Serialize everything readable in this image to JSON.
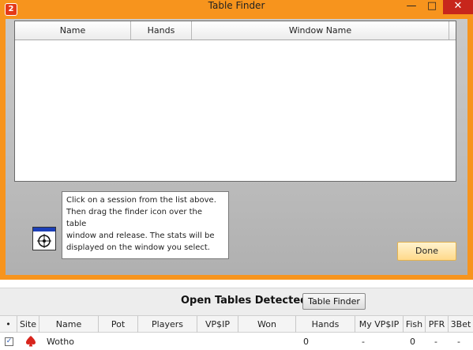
{
  "window": {
    "app_icon_text": "2",
    "title": "Table Finder",
    "controls": {
      "minimize": "—",
      "maximize": "□",
      "close": "✕"
    }
  },
  "session_list": {
    "columns": [
      "Name",
      "Hands",
      "Window Name"
    ],
    "rows": []
  },
  "instructions": "Click on a session from the list above.\nThen drag the finder icon over the table\nwindow and release. The stats will be\ndisplayed on the window you select.",
  "finder_icon": "crosshair-target-icon",
  "done_label": "Done",
  "open_tables": {
    "title": "Open Tables Detected",
    "table_finder_button": "Table Finder",
    "columns": [
      "•",
      "Site",
      "Name",
      "Pot",
      "Players",
      "VP$IP",
      "Won",
      "Hands",
      "My VP$IP",
      "Fish",
      "PFR",
      "3Bet"
    ],
    "rows": [
      {
        "checked": true,
        "site_icon": "poker-spade-icon",
        "name": "Wotho",
        "pot": "",
        "players": "",
        "vpip": "",
        "won": "",
        "hands": "0",
        "my_vpip": "-",
        "fish": "0",
        "pfr": "-",
        "three_bet": "-"
      }
    ]
  },
  "colors": {
    "title_bar": "#f7941d",
    "close_button": "#c7261c",
    "done_button": "#ffd98a",
    "finder_bar": "#1c3fb8"
  }
}
